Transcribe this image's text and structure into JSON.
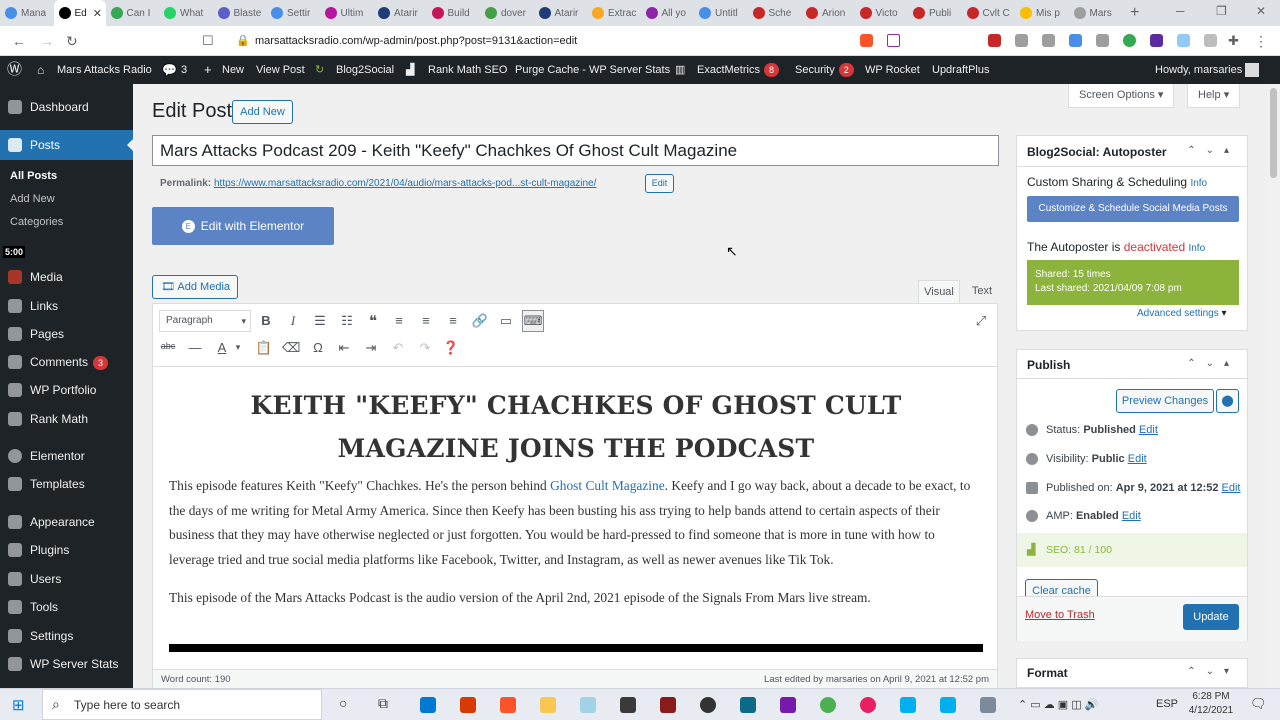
{
  "browser": {
    "tabs": [
      {
        "label": "Mana",
        "color": "#4a8fe7"
      },
      {
        "label": "Ed",
        "color": "#000000",
        "active": true
      },
      {
        "label": "Can I",
        "color": "#34a853"
      },
      {
        "label": "What",
        "color": "#25d366"
      },
      {
        "label": "Blaste",
        "color": "#5b5fc7"
      },
      {
        "label": "Settir",
        "color": "#4a8fe7"
      },
      {
        "label": "Ultim",
        "color": "#b5179e"
      },
      {
        "label": "Atarir",
        "color": "#1d3c78"
      },
      {
        "label": "Build",
        "color": "#c2185b"
      },
      {
        "label": "dover",
        "color": "#43a047"
      },
      {
        "label": "Atarir",
        "color": "#1d3c78"
      },
      {
        "label": "Extrac",
        "color": "#f9a825"
      },
      {
        "label": "All yo",
        "color": "#8e24aa"
      },
      {
        "label": "Untitl",
        "color": "#4a8fe7"
      },
      {
        "label": "Sche",
        "color": "#c62828"
      },
      {
        "label": "Arion",
        "color": "#c62828"
      },
      {
        "label": "Victo",
        "color": "#c62828"
      },
      {
        "label": "Publi",
        "color": "#c62828"
      },
      {
        "label": "Cvlt C",
        "color": "#c62828"
      },
      {
        "label": "Mis p",
        "color": "#fbbc04"
      },
      {
        "label": "Mars",
        "color": "#9e9e9e"
      }
    ],
    "new_tab": "+",
    "url": "marsattacksradio.com/wp-admin/post.php?post=9131&action=edit"
  },
  "adminbar": {
    "site_name": "Mars Attacks Radio",
    "comments_count": "3",
    "new_label": "New",
    "view_post": "View Post",
    "blog2social": "Blog2Social",
    "rankmath": "Rank Math SEO",
    "purge": "Purge Cache - WP Server Stats",
    "exactmetrics": "ExactMetrics",
    "exactmetrics_count": "8",
    "security": "Security",
    "security_count": "2",
    "wprocket": "WP Rocket",
    "updraft": "UpdraftPlus",
    "howdy": "Howdy, marsaries"
  },
  "sidebar": {
    "dashboard": "Dashboard",
    "posts": "Posts",
    "sub_all_posts": "All Posts",
    "sub_add_new": "Add New",
    "sub_categories": "Categories",
    "timer": "5:00",
    "media": "Media",
    "links": "Links",
    "pages": "Pages",
    "comments": "Comments",
    "comments_count": "3",
    "wp_portfolio": "WP Portfolio",
    "rank_math": "Rank Math",
    "elementor": "Elementor",
    "templates": "Templates",
    "appearance": "Appearance",
    "plugins": "Plugins",
    "users": "Users",
    "tools": "Tools",
    "settings": "Settings",
    "wp_server_stats": "WP Server Stats"
  },
  "main": {
    "screen_options": "Screen Options",
    "help": "Help",
    "page_title": "Edit Post",
    "add_new": "Add New",
    "post_title": "Mars Attacks Podcast 209 - Keith \"Keefy\" Chachkes Of Ghost Cult Magazine",
    "permalink_label": "Permalink:",
    "permalink_url": "https://www.marsattacksradio.com/2021/04/audio/mars-attacks-pod...st-cult-magazine/",
    "permalink_edit": "Edit",
    "elementor_btn": "Edit with Elementor",
    "add_media": "Add Media",
    "tab_visual": "Visual",
    "tab_text": "Text",
    "format_select": "Paragraph",
    "heading": "KEITH \"KEEFY\" CHACHKES OF GHOST CULT MAGAZINE JOINS THE PODCAST",
    "para1_before": "This episode features Keith \"Keefy\" Chachkes. He's the person behind ",
    "para1_link": "Ghost Cult Magazine",
    "para1_after": ". Keefy and I go way back, about a decade to be exact, to the days of me writing for Metal Army America. Since then Keefy has been busting his ass trying to help bands attend to certain aspects of their business that they may have otherwise neglected or just forgotten. You would be hard-pressed to find someone that is more in tune with how to leverage tried and true social media platforms like Facebook, Twitter, and Instagram, as well as newer avenues like Tik Tok.",
    "para2": "This episode of the Mars Attacks Podcast is the audio version of the April 2nd, 2021 episode of the Signals From Mars live stream.",
    "word_count": "Word count: 190",
    "last_edited": "Last edited by marsaries on April 9, 2021 at 12:52 pm"
  },
  "blog2social": {
    "title": "Blog2Social: Autoposter",
    "custom_sharing": "Custom Sharing & Scheduling",
    "info1": "Info",
    "customize_btn": "Customize & Schedule Social Media Posts",
    "autoposter_prefix": "The Autoposter is",
    "autoposter_state": "deactivated",
    "info2": "Info",
    "shared": "Shared: 15 times",
    "last_shared": "Last shared: 2021/04/09 7:08 pm",
    "advanced": "Advanced settings"
  },
  "publish": {
    "title": "Publish",
    "preview": "Preview Changes",
    "status_label": "Status:",
    "status_value": "Published",
    "visibility_label": "Visibility:",
    "visibility_value": "Public",
    "published_label": "Published on:",
    "published_value": "Apr 9, 2021 at 12:52",
    "amp_label": "AMP:",
    "amp_value": "Enabled",
    "seo": "SEO: 81 / 100",
    "edit": "Edit",
    "clear_cache": "Clear cache",
    "trash": "Move to Trash",
    "update": "Update"
  },
  "format_panel": {
    "title": "Format"
  },
  "taskbar": {
    "search_placeholder": "Type here to search",
    "lang": "ESP",
    "time": "6:28 PM",
    "date": "4/12/2021"
  },
  "colors": {
    "wp_dark": "#1d2327",
    "wp_blue": "#2271b1",
    "elementor": "#5c83c4",
    "b2s_green": "#8cb43c"
  }
}
